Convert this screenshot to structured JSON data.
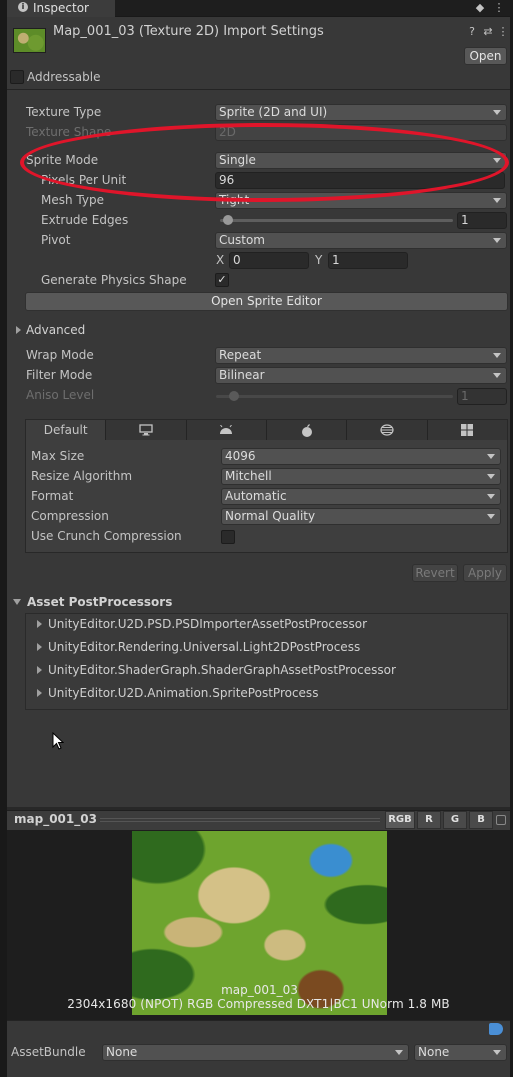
{
  "tab": {
    "title": "Inspector"
  },
  "header": {
    "title": "Map_001_03 (Texture 2D) Import Settings",
    "open_label": "Open",
    "addressable_label": "Addressable"
  },
  "props": {
    "texture_type": {
      "label": "Texture Type",
      "value": "Sprite (2D and UI)"
    },
    "texture_shape": {
      "label": "Texture Shape",
      "value": "2D"
    },
    "sprite_mode": {
      "label": "Sprite Mode",
      "value": "Single"
    },
    "pixels_per_unit": {
      "label": "Pixels Per Unit",
      "value": "96"
    },
    "mesh_type": {
      "label": "Mesh Type",
      "value": "Tight"
    },
    "extrude_edges": {
      "label": "Extrude Edges",
      "value": "1"
    },
    "pivot": {
      "label": "Pivot",
      "value": "Custom",
      "x_label": "X",
      "x_value": "0",
      "y_label": "Y",
      "y_value": "1"
    },
    "generate_physics": {
      "label": "Generate Physics Shape",
      "checked": true
    },
    "open_sprite_editor": "Open Sprite Editor",
    "advanced": "Advanced",
    "wrap_mode": {
      "label": "Wrap Mode",
      "value": "Repeat"
    },
    "filter_mode": {
      "label": "Filter Mode",
      "value": "Bilinear"
    },
    "aniso_level": {
      "label": "Aniso Level",
      "value": "1"
    }
  },
  "platform": {
    "tabs": [
      {
        "label": "Default",
        "icon": ""
      },
      {
        "label": "",
        "icon": "desktop-icon"
      },
      {
        "label": "",
        "icon": "android-icon"
      },
      {
        "label": "",
        "icon": "apple-icon"
      },
      {
        "label": "",
        "icon": "webgl-icon"
      },
      {
        "label": "",
        "icon": "windows-icon"
      }
    ],
    "max_size": {
      "label": "Max Size",
      "value": "4096"
    },
    "resize": {
      "label": "Resize Algorithm",
      "value": "Mitchell"
    },
    "format": {
      "label": "Format",
      "value": "Automatic"
    },
    "compression": {
      "label": "Compression",
      "value": "Normal Quality"
    },
    "crunch": {
      "label": "Use Crunch Compression",
      "checked": false
    }
  },
  "actions": {
    "revert": "Revert",
    "apply": "Apply"
  },
  "postprocessors": {
    "title": "Asset PostProcessors",
    "items": [
      "UnityEditor.U2D.PSD.PSDImporterAssetPostProcessor",
      "UnityEditor.Rendering.Universal.Light2DPostProcess",
      "UnityEditor.ShaderGraph.ShaderGraphAssetPostProcessor",
      "UnityEditor.U2D.Animation.SpritePostProcess"
    ]
  },
  "preview": {
    "name": "map_001_03",
    "channels": [
      "RGB",
      "R",
      "G",
      "B"
    ],
    "image_label": "map_001_03",
    "info": "2304x1680 (NPOT) RGB Compressed DXT1|BC1 UNorm    1.8 MB"
  },
  "bottom": {
    "assetbundle_label": "AssetBundle",
    "bundle_value": "None",
    "variant_value": "None"
  },
  "colors": {
    "highlight": "#e0152a",
    "panel": "#383838"
  }
}
